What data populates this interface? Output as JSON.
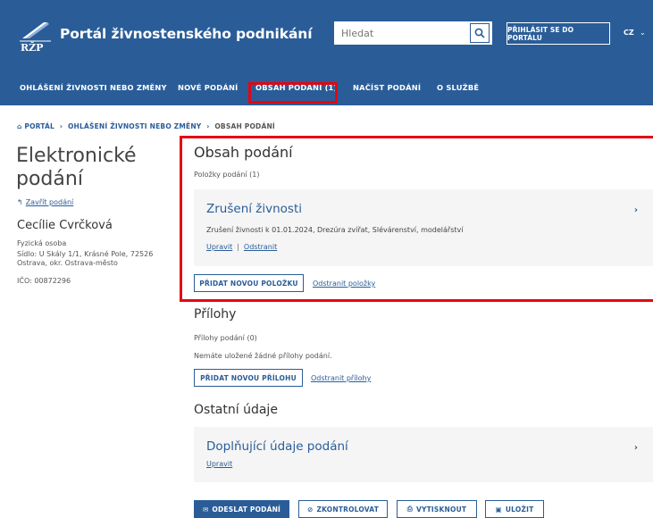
{
  "header": {
    "logo_text": "RŽP",
    "title": "Portál živnostenského podnikání",
    "search_placeholder": "Hledat",
    "login_label": "PŘIHLÁSIT SE DO PORTÁLU",
    "lang": "CZ"
  },
  "nav": {
    "items": [
      {
        "label": "OHLÁŠENÍ ŽIVNOSTI NEBO ZMĚNY"
      },
      {
        "label": "NOVÉ PODÁNÍ"
      },
      {
        "label": "OBSAH PODÁNÍ (1)"
      },
      {
        "label": "NAČÍST PODÁNÍ"
      },
      {
        "label": "O SLUŽBĚ"
      }
    ],
    "active_index": 2
  },
  "breadcrumb": {
    "items": [
      "PORTÁL",
      "OHLÁŠENÍ ŽIVNOSTI NEBO ZMĚNY",
      "OBSAH PODÁNÍ"
    ]
  },
  "sidebar": {
    "title": "Elektronické podání",
    "close_label": "Zavřít podání",
    "person_name": "Cecílie Cvrčková",
    "person_type": "Fyzická osoba",
    "address": "Sídlo: U Skály 1/1, Krásné Pole, 72526 Ostrava, okr. Ostrava-město",
    "ico": "IČO: 00872296"
  },
  "content": {
    "title": "Obsah podání",
    "items_count": "Položky podání (1)",
    "item": {
      "title": "Zrušení živnosti",
      "desc": "Zrušení živnosti k 01.01.2024, Drezúra zvířat, Slévárenství, modelářství",
      "edit": "Upravit",
      "remove": "Odstranit"
    },
    "add_item": "PŘIDAT NOVOU POLOŽKU",
    "remove_items": "Odstranit položky"
  },
  "attachments": {
    "title": "Přílohy",
    "count": "Přílohy podání (0)",
    "empty": "Nemáte uložené žádné přílohy podání.",
    "add": "PŘIDAT NOVOU PŘÍLOHU",
    "remove": "Odstranit přílohy"
  },
  "other": {
    "title": "Ostatní údaje",
    "card_title": "Doplňující údaje podání",
    "edit": "Upravit"
  },
  "footer": {
    "send": "ODESLAT PODÁNÍ",
    "check": "ZKONTROLOVAT",
    "print": "VYTISKNOUT",
    "save": "ULOŽIT"
  },
  "colors": {
    "brand": "#2a5d98",
    "highlight": "#e30613"
  }
}
